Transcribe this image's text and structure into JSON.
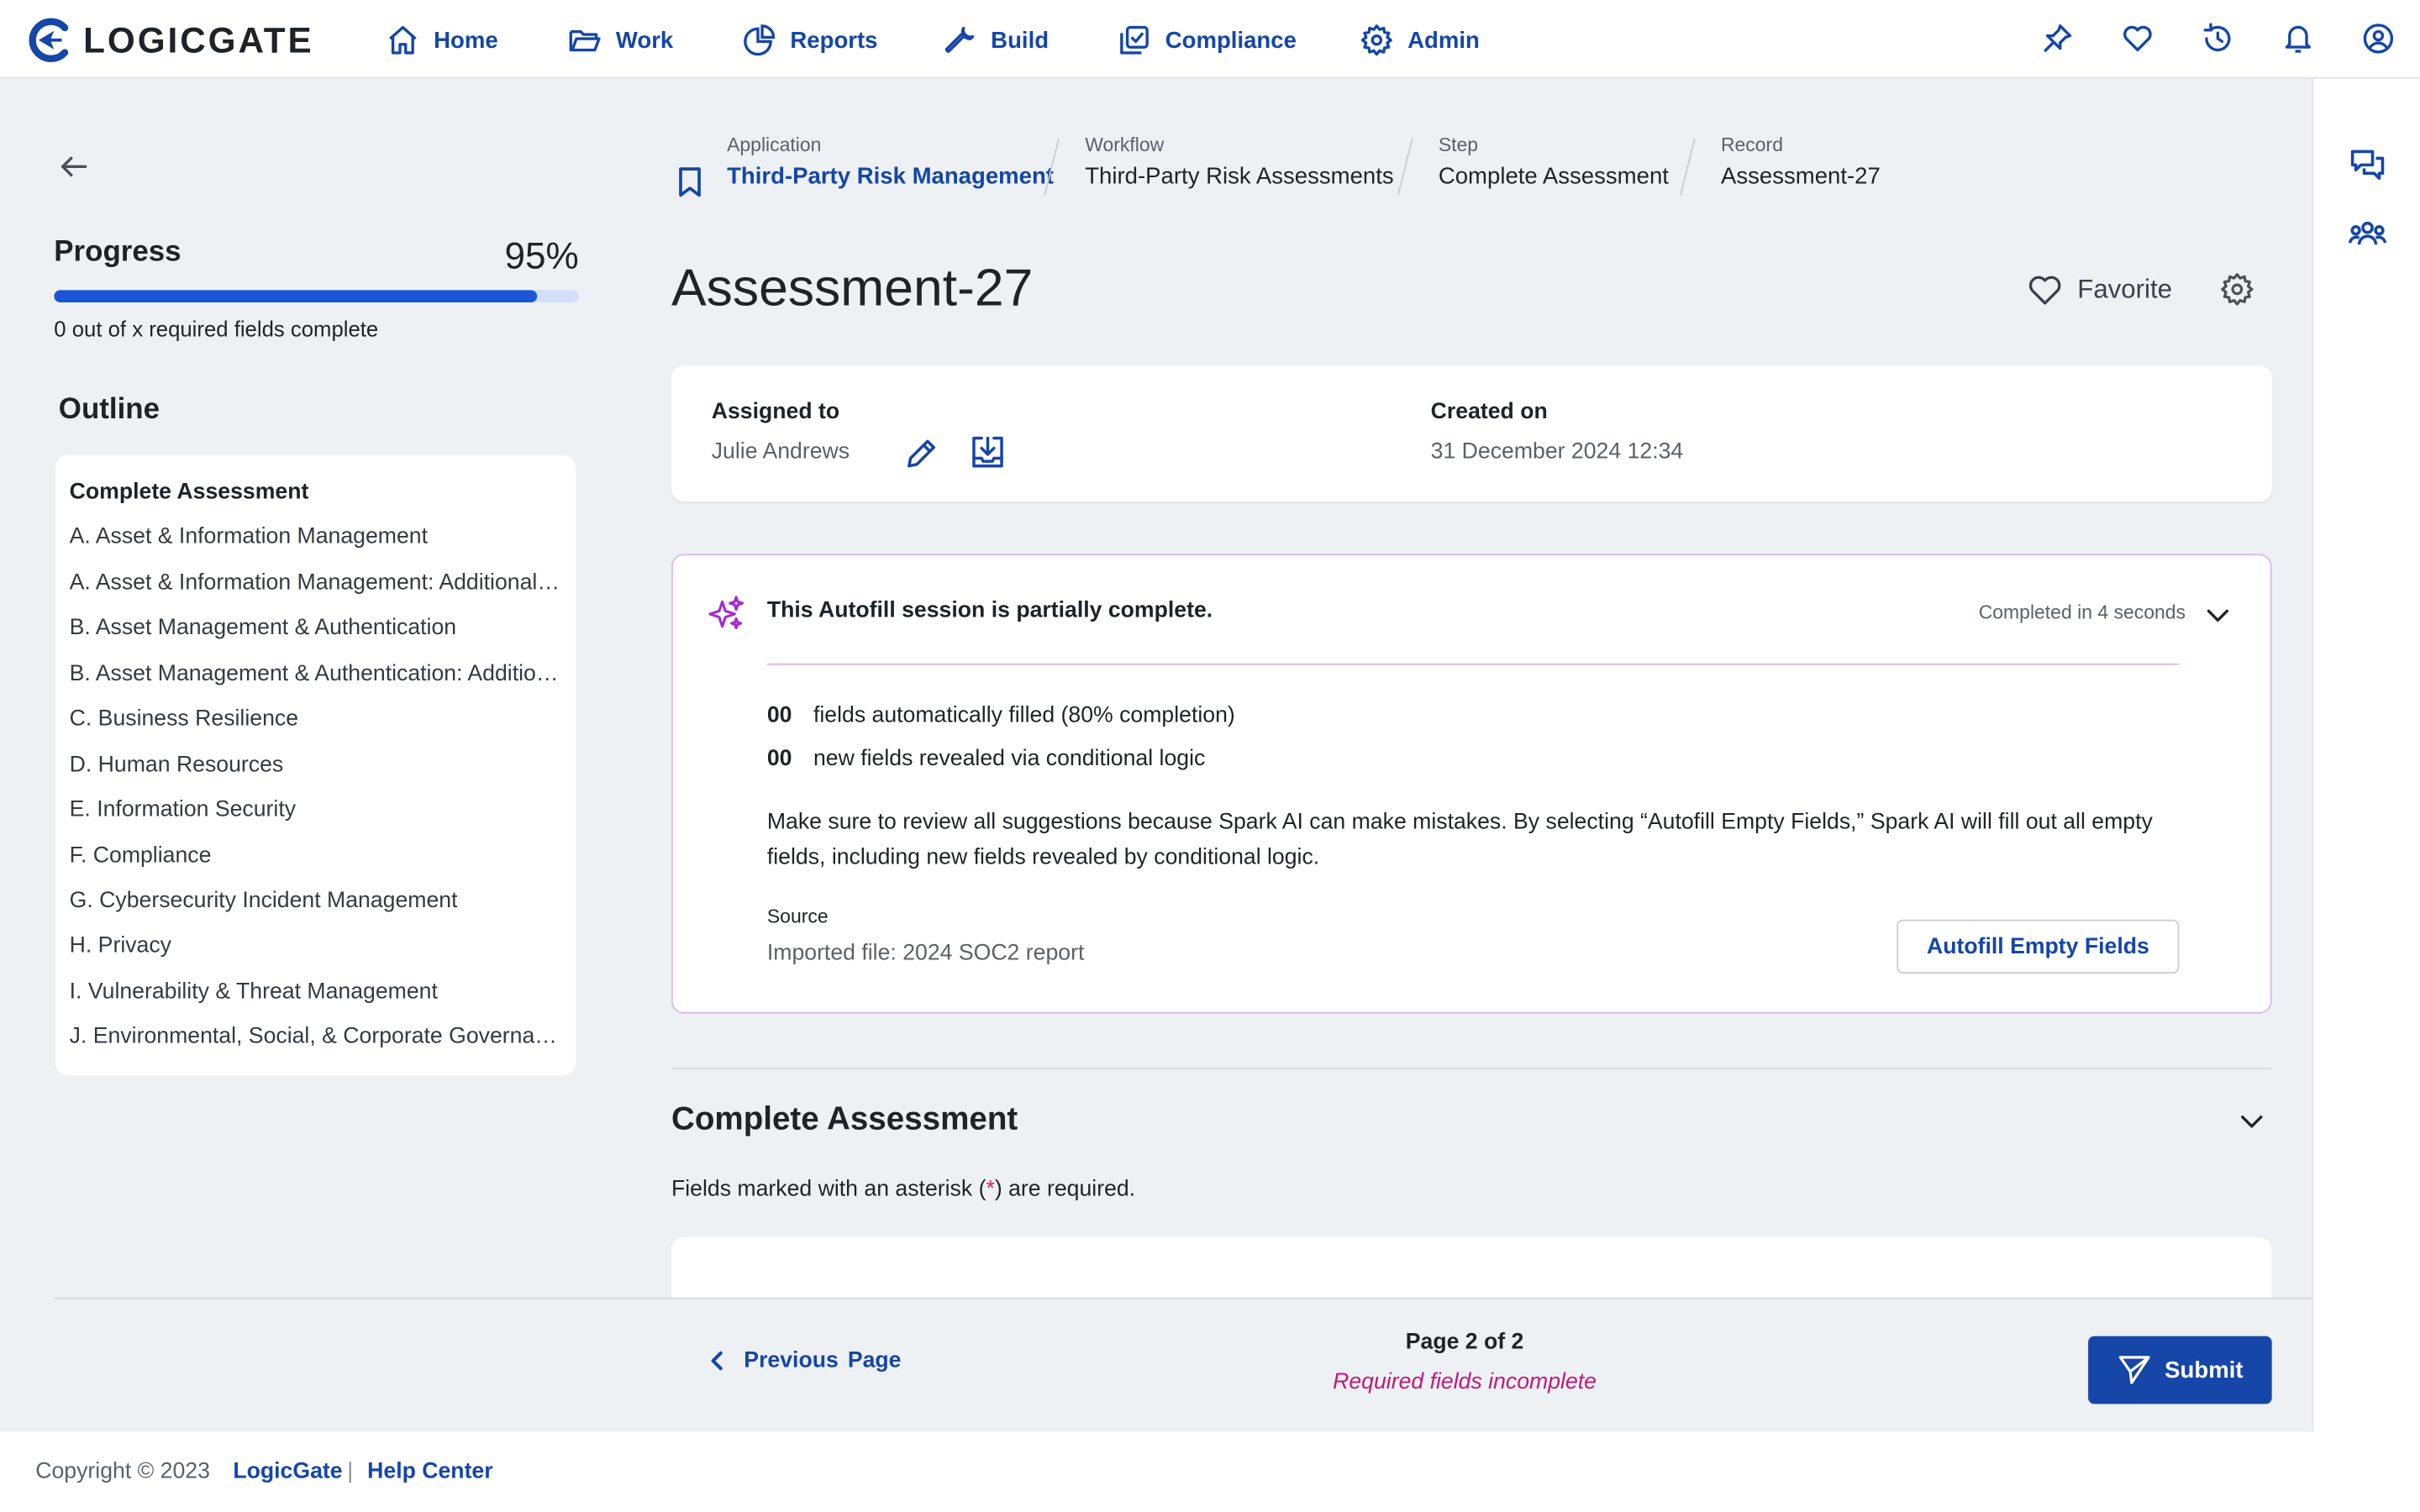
{
  "brand": {
    "name": "LOGICGATE"
  },
  "nav": {
    "items": [
      {
        "label": "Home",
        "icon": "home-icon"
      },
      {
        "label": "Work",
        "icon": "folder-icon"
      },
      {
        "label": "Reports",
        "icon": "pie-chart-icon"
      },
      {
        "label": "Build",
        "icon": "wrench-icon"
      },
      {
        "label": "Compliance",
        "icon": "compliance-check-icon"
      },
      {
        "label": "Admin",
        "icon": "gear-icon"
      }
    ],
    "right_icons": [
      "pin-icon",
      "heart-icon",
      "history-icon",
      "bell-icon",
      "user-circle-icon"
    ]
  },
  "rail": {
    "icons": [
      "chat-bubbles-icon",
      "people-group-icon"
    ]
  },
  "sidebar": {
    "progress_label": "Progress",
    "progress_percent_text": "95%",
    "progress_value": 0.92,
    "progress_sub": "0 out of x required fields complete",
    "outline_title": "Outline",
    "outline_items": [
      "Complete Assessment",
      "A. Asset & Information Management",
      "A. Asset & Information Management: Additional Questions",
      "B. Asset Management & Authentication",
      "B. Asset Management & Authentication: Additional Questions",
      "C. Business Resilience",
      "D. Human Resources",
      "E. Information Security",
      "F. Compliance",
      "G. Cybersecurity Incident Management",
      "H. Privacy",
      "I. Vulnerability & Threat Management",
      "J. Environmental, Social, & Corporate Governance"
    ]
  },
  "breadcrumb": [
    {
      "label": "Application",
      "value": "Third-Party Risk Management"
    },
    {
      "label": "Workflow",
      "value": "Third-Party Risk Assessments"
    },
    {
      "label": "Step",
      "value": "Complete Assessment"
    },
    {
      "label": "Record",
      "value": "Assessment-27"
    }
  ],
  "record": {
    "title": "Assessment-27",
    "favorite_label": "Favorite",
    "assigned_label": "Assigned to",
    "assigned_value": "Julie Andrews",
    "created_label": "Created on",
    "created_value": "31 December 2024 12:34"
  },
  "autofill": {
    "title": "This Autofill session is partially complete.",
    "meta": "Completed in 4 seconds",
    "stats": [
      {
        "count": "00",
        "text": "fields automatically filled (80% completion)"
      },
      {
        "count": "00",
        "text": "new fields revealed via conditional logic"
      }
    ],
    "paragraph": "Make sure to review all suggestions because Spark AI can make mistakes. By selecting “Autofill Empty Fields,” Spark AI will fill out all empty fields, including new fields revealed by conditional logic.",
    "source_label": "Source",
    "source_value": "Imported file: 2024 SOC2 report",
    "button_label": "Autofill Empty Fields"
  },
  "section": {
    "title": "Complete Assessment",
    "note_before": "Fields marked with an asterisk (",
    "asterisk": "*",
    "note_after": ") are required."
  },
  "pager": {
    "prev_label": "Previous",
    "prev_label2": "Page",
    "page_text": "Page 2 of 2",
    "warning": "Required fields incomplete",
    "submit_label": "Submit"
  },
  "footer": {
    "copyright": "Copyright © 2023",
    "link1": "LogicGate",
    "separator": "|",
    "link2": "Help Center"
  },
  "colors": {
    "primary": "#1546a8",
    "progress": "#1a56d6",
    "ai_accent": "#a62ad1",
    "warning": "#c2187a",
    "background": "#eef1f4"
  }
}
